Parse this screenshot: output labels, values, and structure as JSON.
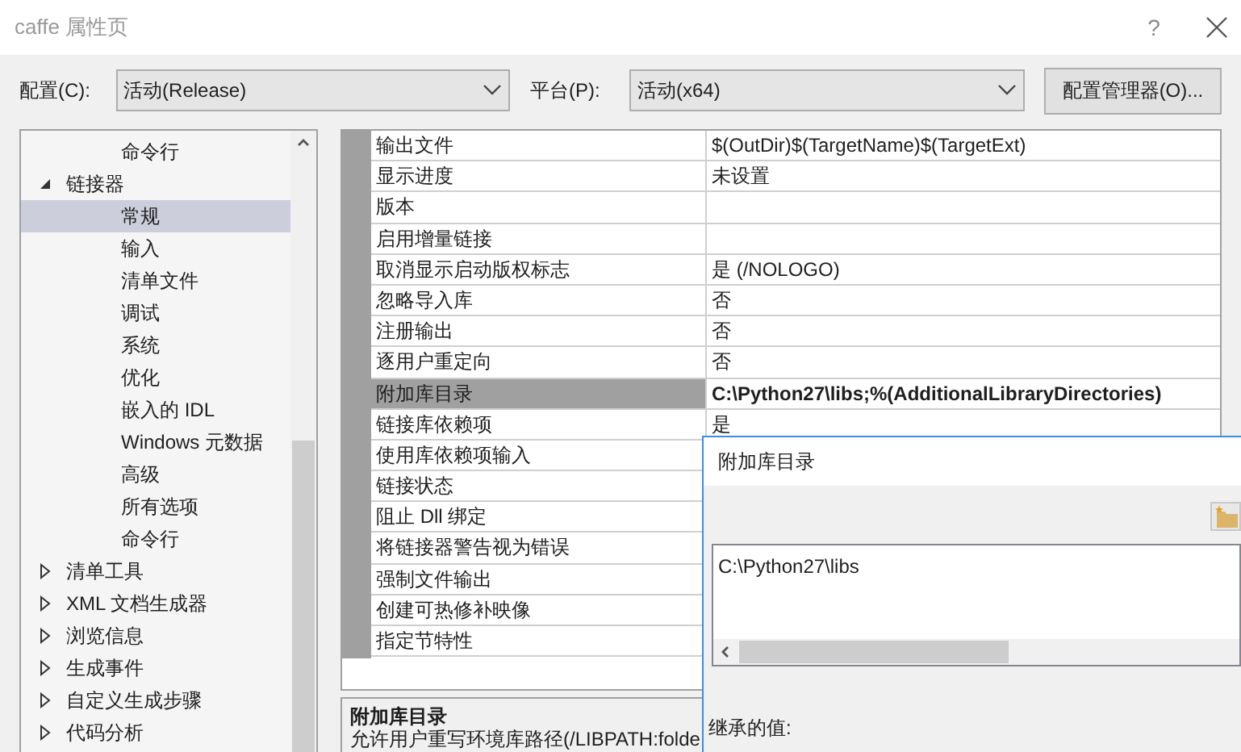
{
  "window": {
    "title": "caffe 属性页",
    "help": "?"
  },
  "toolbar": {
    "config_label": "配置(C):",
    "config_value": "活动(Release)",
    "platform_label": "平台(P):",
    "platform_value": "活动(x64)",
    "manager_button": "配置管理器(O)..."
  },
  "tree": [
    {
      "children": [
        {
          "label": "命令行",
          "selected": false
        }
      ]
    },
    {
      "label": "链接器",
      "expanded": true,
      "selected": false,
      "children": [
        {
          "label": "常规",
          "selected": true
        },
        {
          "label": "输入",
          "selected": false
        },
        {
          "label": "清单文件",
          "selected": false
        },
        {
          "label": "调试",
          "selected": false
        },
        {
          "label": "系统",
          "selected": false
        },
        {
          "label": "优化",
          "selected": false
        },
        {
          "label": "嵌入的 IDL",
          "selected": false
        },
        {
          "label": "Windows 元数据",
          "selected": false
        },
        {
          "label": "高级",
          "selected": false
        },
        {
          "label": "所有选项",
          "selected": false
        },
        {
          "label": "命令行",
          "selected": false
        }
      ]
    },
    {
      "label": "清单工具",
      "expanded": false,
      "selected": false
    },
    {
      "label": "XML 文档生成器",
      "expanded": false,
      "selected": false
    },
    {
      "label": "浏览信息",
      "expanded": false,
      "selected": false
    },
    {
      "label": "生成事件",
      "expanded": false,
      "selected": false
    },
    {
      "label": "自定义生成步骤",
      "expanded": false,
      "selected": false
    },
    {
      "label": "代码分析",
      "expanded": false,
      "selected": false
    }
  ],
  "properties": [
    {
      "name": "输出文件",
      "value": "$(OutDir)$(TargetName)$(TargetExt)",
      "selected": false,
      "modified": false
    },
    {
      "name": "显示进度",
      "value": "未设置",
      "selected": false,
      "modified": false
    },
    {
      "name": "版本",
      "selected": false
    },
    {
      "name": "启用增量链接",
      "selected": false
    },
    {
      "name": "取消显示启动版权标志",
      "value": "是 (/NOLOGO)",
      "selected": false,
      "modified": false
    },
    {
      "name": "忽略导入库",
      "value": "否",
      "selected": false,
      "modified": false
    },
    {
      "name": "注册输出",
      "value": "否",
      "selected": false,
      "modified": false
    },
    {
      "name": "逐用户重定向",
      "value": "否",
      "selected": false,
      "modified": false
    },
    {
      "name": "附加库目录",
      "value": "C:\\Python27\\libs;%(AdditionalLibraryDirectories)",
      "selected": true,
      "modified": true
    },
    {
      "name": "链接库依赖项",
      "value": "是",
      "selected": false,
      "modified": false
    },
    {
      "name": "使用库依赖项输入",
      "selected": false
    },
    {
      "name": "链接状态",
      "selected": false
    },
    {
      "name": "阻止 Dll 绑定",
      "selected": false
    },
    {
      "name": "将链接器警告视为错误",
      "selected": false
    },
    {
      "name": "强制文件输出",
      "selected": false
    },
    {
      "name": "创建可热修补映像",
      "selected": false
    },
    {
      "name": "指定节特性",
      "selected": false
    }
  ],
  "description": {
    "title": "附加库目录",
    "text": "允许用户重写环境库路径(/LIBPATH:folde"
  },
  "popup": {
    "title": "附加库目录",
    "entries": [
      "C:\\Python27\\libs"
    ],
    "inherited_label": "继承的值:"
  }
}
